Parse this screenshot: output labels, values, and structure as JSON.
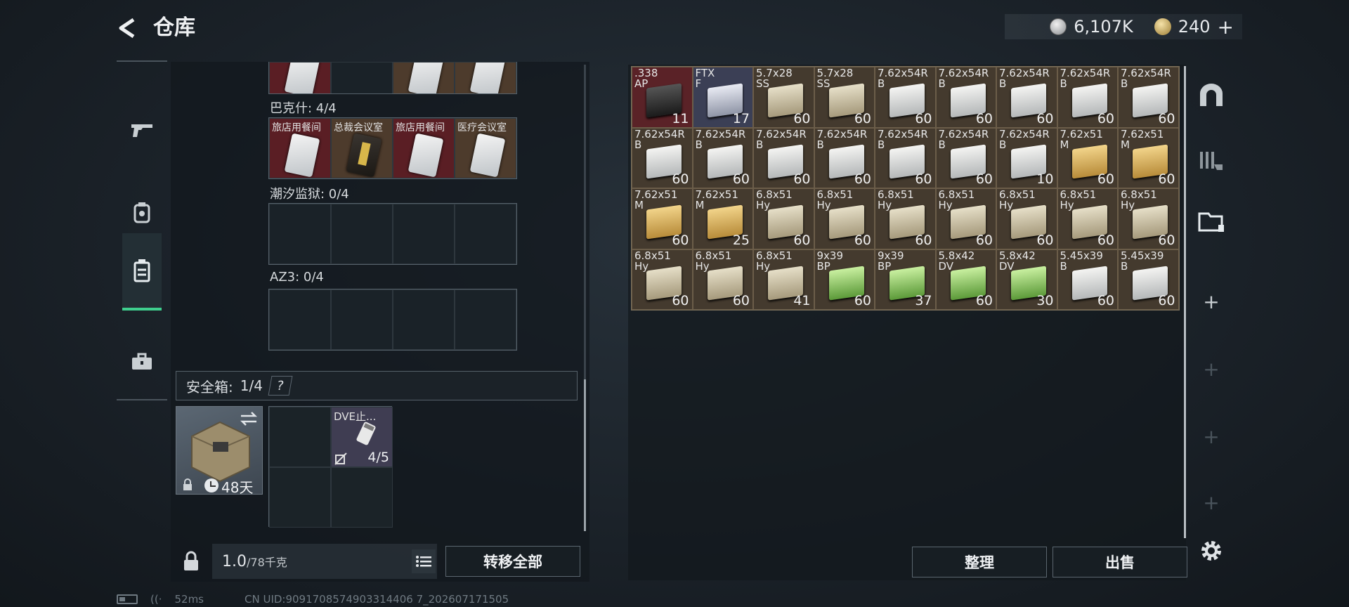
{
  "header": {
    "title": "仓库",
    "silver": "6,107K",
    "gold": "240"
  },
  "warehouse": {
    "sections": [
      {
        "label": "巴克什: 4/4",
        "cards": [
          "旅店用餐间",
          "总裁会议室",
          "旅店用餐间",
          "医疗会议室"
        ]
      },
      {
        "label": "潮汐监狱: 0/4"
      },
      {
        "label": "AZ3: 0/4"
      }
    ],
    "safe_box": {
      "label": "安全箱:",
      "count": "1/4",
      "help": "?",
      "timer": "48天"
    },
    "safe_item": {
      "name": "DVE止...",
      "uses": "4/5"
    },
    "weight": {
      "current": "1.0",
      "max": "/78千克"
    },
    "transfer_all": "转移全部"
  },
  "stash": {
    "items": [
      {
        "name": ".338\nAP",
        "count": "11",
        "style": "red",
        "box": "dk"
      },
      {
        "name": "FTX\nF",
        "count": "17",
        "style": "blue",
        "box": "sv"
      },
      {
        "name": "5.7x28\nSS",
        "count": "60",
        "box": "cr"
      },
      {
        "name": "5.7x28\nSS",
        "count": "60",
        "box": "cr"
      },
      {
        "name": "7.62x54R\nB",
        "count": "60",
        "box": "wh"
      },
      {
        "name": "7.62x54R\nB",
        "count": "60",
        "box": "wh"
      },
      {
        "name": "7.62x54R\nB",
        "count": "60",
        "box": "wh"
      },
      {
        "name": "7.62x54R\nB",
        "count": "60",
        "box": "wh"
      },
      {
        "name": "7.62x54R\nB",
        "count": "60",
        "box": "wh"
      },
      {
        "name": "7.62x54R\nB",
        "count": "60",
        "box": "wh"
      },
      {
        "name": "7.62x54R\nB",
        "count": "60",
        "box": "wh"
      },
      {
        "name": "7.62x54R\nB",
        "count": "60",
        "box": "wh"
      },
      {
        "name": "7.62x54R\nB",
        "count": "60",
        "box": "wh"
      },
      {
        "name": "7.62x54R\nB",
        "count": "60",
        "box": "wh"
      },
      {
        "name": "7.62x54R\nB",
        "count": "60",
        "box": "wh"
      },
      {
        "name": "7.62x54R\nB",
        "count": "10",
        "box": "wh"
      },
      {
        "name": "7.62x51\nM",
        "count": "60",
        "box": "gd"
      },
      {
        "name": "7.62x51\nM",
        "count": "60",
        "box": "gd"
      },
      {
        "name": "7.62x51\nM",
        "count": "60",
        "box": "gd"
      },
      {
        "name": "7.62x51\nM",
        "count": "25",
        "box": "gd"
      },
      {
        "name": "6.8x51\nHy",
        "count": "60",
        "box": "cr"
      },
      {
        "name": "6.8x51\nHy",
        "count": "60",
        "box": "cr"
      },
      {
        "name": "6.8x51\nHy",
        "count": "60",
        "box": "cr"
      },
      {
        "name": "6.8x51\nHy",
        "count": "60",
        "box": "cr"
      },
      {
        "name": "6.8x51\nHy",
        "count": "60",
        "box": "cr"
      },
      {
        "name": "6.8x51\nHy",
        "count": "60",
        "box": "cr"
      },
      {
        "name": "6.8x51\nHy",
        "count": "60",
        "box": "cr"
      },
      {
        "name": "6.8x51\nHy",
        "count": "60",
        "box": "cr"
      },
      {
        "name": "6.8x51\nHy",
        "count": "60",
        "box": "cr"
      },
      {
        "name": "6.8x51\nHy",
        "count": "41",
        "box": "cr"
      },
      {
        "name": "9x39\nBP",
        "count": "60",
        "box": "gr"
      },
      {
        "name": "9x39\nBP",
        "count": "37",
        "box": "gr"
      },
      {
        "name": "5.8x42\nDV",
        "count": "60",
        "box": "gr"
      },
      {
        "name": "5.8x42\nDV",
        "count": "30",
        "box": "gr"
      },
      {
        "name": "5.45x39\nB",
        "count": "60",
        "box": "wh"
      },
      {
        "name": "5.45x39\nB",
        "count": "60",
        "box": "wh"
      }
    ],
    "sort_btn": "整理",
    "sell_btn": "出售"
  },
  "status": {
    "ping": "52ms",
    "uid": "CN UID:9091708574903314406 7_202607171505"
  }
}
